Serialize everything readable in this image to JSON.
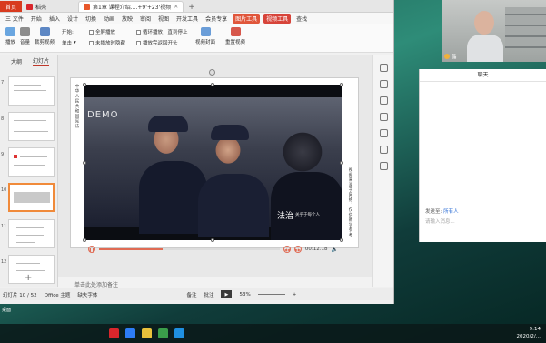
{
  "tabs": [
    {
      "label": "首页"
    },
    {
      "label": "稻壳"
    },
    {
      "label": "第1章 课程介绍....+9'+23'视频"
    }
  ],
  "menu": [
    "三 文件",
    "开始",
    "插入",
    "设计",
    "切换",
    "动画",
    "放映",
    "审阅",
    "视图",
    "开发工具",
    "会员专享",
    "稻壳资源"
  ],
  "menu_highlight": "图片工具",
  "menu_video": "视频工具",
  "search_label": "查找",
  "ribbon": {
    "play": "播放",
    "volume": "音量",
    "crop": "裁剪视频",
    "single": "单击",
    "start": "开始:",
    "fullscreen": "全屏播放",
    "hide": "未播放时隐藏",
    "loop": "循环播放，直到停止",
    "rewind": "播放完返回开头",
    "cover": "视频封面",
    "reset": "重置视频"
  },
  "left_tabs": {
    "outline": "大纲",
    "slides": "幻灯片"
  },
  "slide_numbers": [
    "7",
    "8",
    "9",
    "10",
    "11",
    "12"
  ],
  "video": {
    "watermark": "DEMO",
    "caption_main": "法治",
    "caption_sub": "关乎于每个人",
    "left_vertical": "中华人民共和国宪法",
    "right_vertical": "视频来源于网络，仅供教学参考",
    "time": "00:12.18",
    "progress": 0.35
  },
  "notes_placeholder": "单击此处添加备注",
  "status": {
    "slide": "幻灯片 10 / 52",
    "theme": "Office 主题",
    "missing_font": "缺失字体",
    "notes": "备注",
    "comment": "批注",
    "zoom": "53%"
  },
  "camera": {
    "name": "晶"
  },
  "chat": {
    "title": "聊天",
    "send_to_label": "发送至:",
    "send_to_value": "所有人",
    "input_placeholder": "请输入消息..."
  },
  "desktop": {
    "label": "桌面"
  },
  "tray": {
    "time": "9:14",
    "date": "2020/2/..."
  }
}
